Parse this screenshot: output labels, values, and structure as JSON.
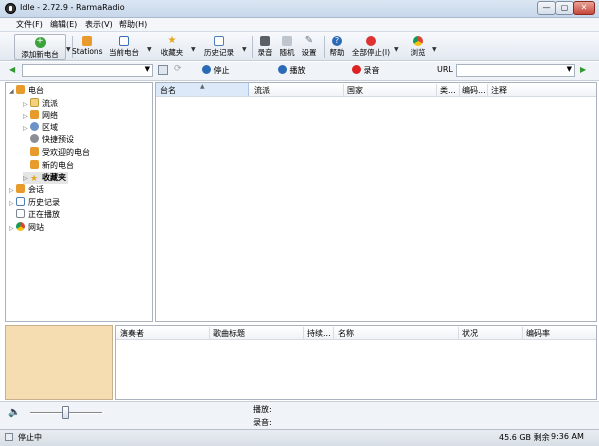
{
  "window": {
    "title": "Idle - 2.72.9 - RarmaRadio",
    "min": "—",
    "max": "▢",
    "close": "✕"
  },
  "menu": [
    "文件(F)",
    "编辑(E)",
    "表示(V)",
    "帮助(H)"
  ],
  "toolbar": {
    "add": "添加新电台",
    "stations": "Stations",
    "current": "当前电台",
    "favorites": "收藏夹",
    "history": "历史记录",
    "record": "录音",
    "random": "随机",
    "settings": "设置",
    "help": "帮助",
    "stop_all": "全部停止(I)",
    "browse": "浏览"
  },
  "addrow": {
    "stop": "停止",
    "play": "播放",
    "rec": "录音",
    "url_label": "URL",
    "station_value": "",
    "url_value": ""
  },
  "tree": {
    "root": "电台",
    "children": [
      "流派",
      "网络",
      "区域",
      "快捷预设",
      "受欢迎的电台",
      "新的电台",
      "收藏夹"
    ],
    "others": [
      "会话",
      "历史记录",
      "正在播放",
      "网站"
    ]
  },
  "list": {
    "columns": [
      "台名",
      "流派",
      "国家",
      "类...",
      "编码...",
      "注释"
    ]
  },
  "tracks": {
    "columns": [
      "演奏者",
      "歌曲标题",
      "持续...",
      "名称",
      "状况",
      "编码率"
    ]
  },
  "player": {
    "play_label": "播放:",
    "rec_label": "录音:"
  },
  "status": {
    "state": "停止中",
    "disk": "45.6 GB 剩余",
    "time": "9:36 AM"
  },
  "colors": {
    "accent": "#2a6ab7",
    "art_bg": "#f5dcb1"
  }
}
